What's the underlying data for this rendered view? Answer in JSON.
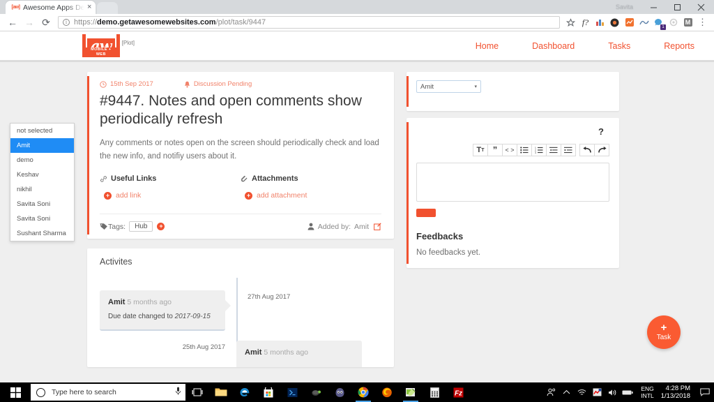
{
  "browser": {
    "tab": {
      "title": "Awesome Apps Demo - ",
      "favicon": "aw-logo-icon",
      "close": "×"
    },
    "window": {
      "user": "Savita",
      "minimize": "minimize-icon",
      "maximize": "maximize-icon",
      "close": "close-icon"
    },
    "nav": {
      "back": "←",
      "forward": "→",
      "reload": "⟳"
    },
    "url": {
      "scheme": "https://",
      "domain": "demo.getawesomewebsites.com",
      "path": "/plot/task/9447",
      "full": "https://demo.getawesomewebsites.com/plot/task/9447"
    },
    "toolbar_icons": [
      "bookmark-star-icon",
      "f-question-extension-icon",
      "chart-extension-icon",
      "camera-extension-icon",
      "analytics-extension-icon",
      "wave-extension-icon",
      "messenger-extension-icon",
      "gear-extension-icon",
      "mail-extension-icon",
      "chrome-menu-icon"
    ],
    "badge": "1"
  },
  "site": {
    "logo": {
      "mark": "aw",
      "sub": "MOBILE + WEB",
      "product": "[Plot]"
    },
    "nav": [
      {
        "label": "Home"
      },
      {
        "label": "Dashboard"
      },
      {
        "label": "Tasks"
      },
      {
        "label": "Reports"
      }
    ]
  },
  "task": {
    "date": "15th Sep 2017",
    "date_icon": "clock-icon",
    "status": "Discussion Pending",
    "status_icon": "bell-icon",
    "title": "#9447. Notes and open comments show periodically refresh",
    "description": "Any comments or notes open on the screen should periodically check and load the new info, and notifiy users about it.",
    "useful_links": {
      "heading": "Useful Links",
      "icon": "link-icon",
      "add_label": "add link"
    },
    "attachments": {
      "heading": "Attachments",
      "icon": "paperclip-icon",
      "add_label": "add attachment"
    },
    "tags": {
      "label": "Tags:",
      "icon": "tag-icon",
      "items": [
        "Hub"
      ],
      "add_icon": "plus-circle-icon"
    },
    "added_by": {
      "label": "Added by:",
      "name": "Amit",
      "avatar_icon": "user-icon",
      "edit_icon": "edit-square-icon"
    }
  },
  "activities": {
    "title": "Activites",
    "entries": [
      {
        "side": "left",
        "author": "Amit",
        "time": "5 months ago",
        "body_prefix": "Due date changed to ",
        "body_value": "2017-09-15",
        "date": "27th Aug 2017"
      },
      {
        "side": "right",
        "author": "Amit",
        "time": "5 months ago",
        "date": "25th Aug 2017"
      }
    ]
  },
  "assignee": {
    "selected": "Amit",
    "caret": "▾",
    "options": [
      {
        "label": "not selected",
        "selected": false
      },
      {
        "label": "Amit",
        "selected": true
      },
      {
        "label": "demo",
        "selected": false
      },
      {
        "label": "Keshav",
        "selected": false
      },
      {
        "label": "nikhil",
        "selected": false
      },
      {
        "label": "Savita Soni",
        "selected": false
      },
      {
        "label": "Savita Soni",
        "selected": false
      },
      {
        "label": "Sushant Sharma",
        "selected": false
      }
    ]
  },
  "discussion": {
    "heading": "?",
    "editor_buttons": [
      {
        "name": "font-size-icon",
        "glyph": "ᴛᴛ"
      },
      {
        "name": "blockquote-icon",
        "glyph": "”"
      },
      {
        "name": "code-icon",
        "glyph": "<>"
      },
      {
        "name": "bullet-list-icon",
        "glyph": "list"
      },
      {
        "name": "numbered-list-icon",
        "glyph": "olist"
      },
      {
        "name": "outdent-icon",
        "glyph": "outdent"
      },
      {
        "name": "indent-icon",
        "glyph": "indent"
      },
      {
        "name": "undo-icon",
        "glyph": "undo"
      },
      {
        "name": "redo-icon",
        "glyph": "redo"
      }
    ],
    "editor_value": "",
    "post_label": ""
  },
  "feedbacks": {
    "heading": "Feedbacks",
    "empty": "No feedbacks yet."
  },
  "fab": {
    "plus": "+",
    "label": "Task"
  },
  "taskbar": {
    "start_icon": "windows-start-icon",
    "search_placeholder": "Type here to search",
    "mic_icon": "microphone-icon",
    "apps": [
      {
        "name": "task-view-icon"
      },
      {
        "name": "file-explorer-icon"
      },
      {
        "name": "edge-icon"
      },
      {
        "name": "microsoft-store-icon"
      },
      {
        "name": "powershell-icon"
      },
      {
        "name": "tortoise-icon"
      },
      {
        "name": "gimp-icon"
      },
      {
        "name": "chrome-icon",
        "active": true
      },
      {
        "name": "firefox-icon"
      },
      {
        "name": "notepadpp-icon",
        "active": true
      },
      {
        "name": "calculator-icon"
      },
      {
        "name": "filezilla-icon"
      }
    ],
    "tray": [
      {
        "name": "people-icon"
      },
      {
        "name": "show-hidden-icons-icon"
      },
      {
        "name": "network-icon"
      },
      {
        "name": "antivirus-icon"
      },
      {
        "name": "volume-icon"
      },
      {
        "name": "battery-icon"
      }
    ],
    "language": {
      "line1": "ENG",
      "line2": "INTL"
    },
    "clock": {
      "time": "4:28 PM",
      "date": "1/13/2018"
    },
    "action_center_icon": "action-center-icon"
  },
  "colors": {
    "accent": "#f1512f",
    "accent_light": "#f1826a",
    "select_highlight": "#1f8cf5",
    "page_bg": "#efefef",
    "fab": "#fa5b32"
  }
}
